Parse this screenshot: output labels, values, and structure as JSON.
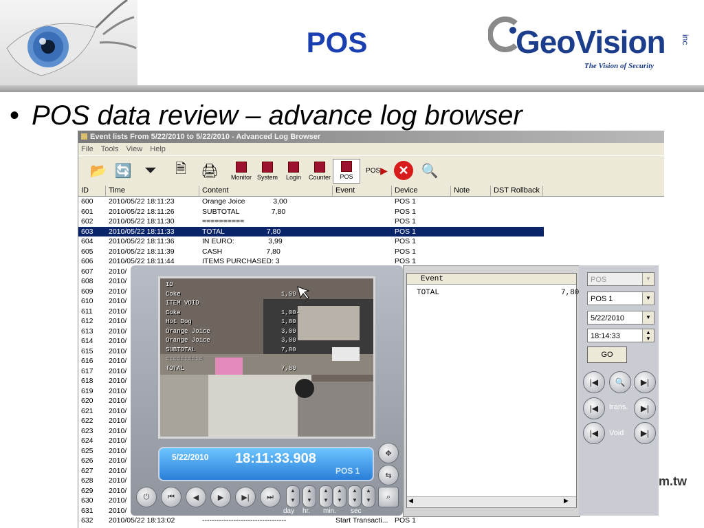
{
  "slide": {
    "title": "POS",
    "bullet": "POS data review – advance log browser",
    "logo": {
      "name": "GeoVision",
      "inc": "inc",
      "tagline": "The Vision of Security"
    },
    "corner_text": "m.tw"
  },
  "window": {
    "title": "Event lists From 5/22/2010 to 5/22/2010 - Advanced Log Browser",
    "menu": [
      "File",
      "Tools",
      "View",
      "Help"
    ],
    "toolbar_labels": [
      "Monitor",
      "System",
      "Login",
      "Counter",
      "POS"
    ],
    "columns": [
      "ID",
      "Time",
      "Content",
      "Event",
      "Device",
      "Note",
      "DST Rollback"
    ],
    "rows": [
      {
        "id": "600",
        "time": "2010/05/22 18:11:23",
        "content": "Orange Joice              3,00",
        "event": "",
        "device": "POS 1"
      },
      {
        "id": "601",
        "time": "2010/05/22 18:11:26",
        "content": "SUBTOTAL                7,80",
        "event": "",
        "device": "POS 1"
      },
      {
        "id": "602",
        "time": "2010/05/22 18:11:30",
        "content": "==========",
        "event": "",
        "device": "POS 1"
      },
      {
        "id": "603",
        "time": "2010/05/22 18:11:33",
        "content": "TOTAL                     7,80",
        "event": "",
        "device": "POS 1",
        "selected": true
      },
      {
        "id": "604",
        "time": "2010/05/22 18:11:36",
        "content": "IN EURO:                 3,99",
        "event": "",
        "device": "POS 1"
      },
      {
        "id": "605",
        "time": "2010/05/22 18:11:39",
        "content": "CASH                      7,80",
        "event": "",
        "device": "POS 1"
      },
      {
        "id": "606",
        "time": "2010/05/22 18:11:44",
        "content": "ITEMS PURCHASED: 3",
        "event": "",
        "device": "POS 1"
      },
      {
        "id": "607",
        "time": "2010/",
        "content": "",
        "event": "",
        "device": ""
      },
      {
        "id": "608",
        "time": "2010/",
        "content": "",
        "event": "",
        "device": ""
      },
      {
        "id": "609",
        "time": "2010/",
        "content": "",
        "event": "",
        "device": ""
      },
      {
        "id": "610",
        "time": "2010/",
        "content": "",
        "event": "",
        "device": ""
      },
      {
        "id": "611",
        "time": "2010/",
        "content": "",
        "event": "",
        "device": ""
      },
      {
        "id": "612",
        "time": "2010/",
        "content": "",
        "event": "",
        "device": ""
      },
      {
        "id": "613",
        "time": "2010/",
        "content": "",
        "event": "",
        "device": ""
      },
      {
        "id": "614",
        "time": "2010/",
        "content": "",
        "event": "",
        "device": ""
      },
      {
        "id": "615",
        "time": "2010/",
        "content": "",
        "event": "",
        "device": ""
      },
      {
        "id": "616",
        "time": "2010/",
        "content": "",
        "event": "",
        "device": ""
      },
      {
        "id": "617",
        "time": "2010/",
        "content": "",
        "event": "",
        "device": ""
      },
      {
        "id": "618",
        "time": "2010/",
        "content": "",
        "event": "",
        "device": ""
      },
      {
        "id": "619",
        "time": "2010/",
        "content": "",
        "event": "",
        "device": ""
      },
      {
        "id": "620",
        "time": "2010/",
        "content": "",
        "event": "",
        "device": ""
      },
      {
        "id": "621",
        "time": "2010/",
        "content": "",
        "event": "",
        "device": ""
      },
      {
        "id": "622",
        "time": "2010/",
        "content": "",
        "event": "",
        "device": ""
      },
      {
        "id": "623",
        "time": "2010/",
        "content": "",
        "event": "",
        "device": ""
      },
      {
        "id": "624",
        "time": "2010/",
        "content": "",
        "event": "",
        "device": ""
      },
      {
        "id": "625",
        "time": "2010/",
        "content": "",
        "event": "",
        "device": ""
      },
      {
        "id": "626",
        "time": "2010/",
        "content": "",
        "event": "",
        "device": ""
      },
      {
        "id": "627",
        "time": "2010/",
        "content": "",
        "event": "",
        "device": ""
      },
      {
        "id": "628",
        "time": "2010/",
        "content": "",
        "event": "",
        "device": ""
      },
      {
        "id": "629",
        "time": "2010/",
        "content": "",
        "event": "",
        "device": ""
      },
      {
        "id": "630",
        "time": "2010/",
        "content": "",
        "event": "",
        "device": ""
      },
      {
        "id": "631",
        "time": "2010/",
        "content": "",
        "event": "",
        "device": ""
      },
      {
        "id": "632",
        "time": "2010/05/22 18:13:02",
        "content": "-----------------------------------",
        "event": "Start Transacti...",
        "device": "POS 1"
      }
    ]
  },
  "player": {
    "overlay": [
      {
        "text": "ID",
        "val": ""
      },
      {
        "text": "Coke",
        "val": "1,00"
      },
      {
        "text": "ITEM VOID",
        "val": ""
      },
      {
        "text": "Coke",
        "val": "1,00-"
      },
      {
        "text": "Hot Dog",
        "val": "1,80"
      },
      {
        "text": "Orange Joice",
        "val": "3,00"
      },
      {
        "text": "Orange Joice",
        "val": "3,00"
      },
      {
        "text": "SUBTOTAL",
        "val": "7,80"
      },
      {
        "text": "==========",
        "val": ""
      },
      {
        "text": "TOTAL",
        "val": "7,80"
      }
    ],
    "date": "5/22/2010",
    "time": "18:11:33.908",
    "channel": "POS 1",
    "spin_labels": [
      "day",
      "hr.",
      "min.",
      "sec"
    ]
  },
  "event_pane": {
    "header": "Event",
    "row_text": "TOTAL",
    "row_value": "7,80"
  },
  "side": {
    "type_select": "POS",
    "device_select": "POS 1",
    "date": "5/22/2010",
    "time": "18:14:33",
    "go_label": "GO",
    "trans_label": "trans.",
    "void_label": "Void"
  }
}
